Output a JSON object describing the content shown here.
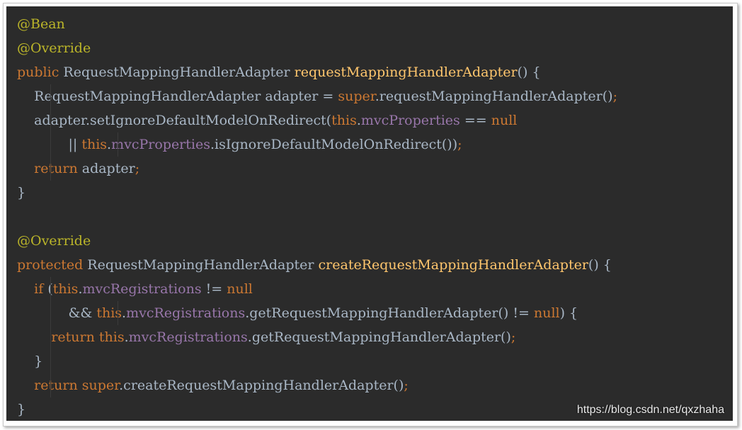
{
  "colors": {
    "background": "#2b2b2b",
    "annotation": "#bbb529",
    "keyword": "#cc7832",
    "method": "#ffc66d",
    "field": "#9876aa",
    "default": "#a9b7c6"
  },
  "code": {
    "lines": [
      {
        "tokens": [
          {
            "t": "@Bean",
            "k": "ann"
          }
        ]
      },
      {
        "tokens": [
          {
            "t": "@Override",
            "k": "ann"
          }
        ]
      },
      {
        "tokens": [
          {
            "t": "public",
            "k": "kw"
          },
          {
            "t": " RequestMappingHandlerAdapter ",
            "k": "def"
          },
          {
            "t": "requestMappingHandlerAdapter",
            "k": "fn"
          },
          {
            "t": "() {",
            "k": "def"
          }
        ]
      },
      {
        "guides": [
          0
        ],
        "tokens": [
          {
            "t": "    RequestMappingHandlerAdapter adapter = ",
            "k": "def"
          },
          {
            "t": "super",
            "k": "kw"
          },
          {
            "t": ".requestMappingHandlerAdapter()",
            "k": "def"
          },
          {
            "t": ";",
            "k": "sym"
          }
        ]
      },
      {
        "guides": [
          0
        ],
        "tokens": [
          {
            "t": "    adapter.setIgnoreDefaultModelOnRedirect(",
            "k": "def"
          },
          {
            "t": "this",
            "k": "kw"
          },
          {
            "t": ".",
            "k": "def"
          },
          {
            "t": "mvcProperties",
            "k": "fld"
          },
          {
            "t": " == ",
            "k": "def"
          },
          {
            "t": "null",
            "k": "kw"
          }
        ]
      },
      {
        "guides": [
          0,
          1
        ],
        "tokens": [
          {
            "t": "            || ",
            "k": "def"
          },
          {
            "t": "this",
            "k": "kw"
          },
          {
            "t": ".",
            "k": "def"
          },
          {
            "t": "mvcProperties",
            "k": "fld"
          },
          {
            "t": ".isIgnoreDefaultModelOnRedirect())",
            "k": "def"
          },
          {
            "t": ";",
            "k": "sym"
          }
        ]
      },
      {
        "guides": [
          0
        ],
        "tokens": [
          {
            "t": "    ",
            "k": "def"
          },
          {
            "t": "return",
            "k": "kw"
          },
          {
            "t": " adapter",
            "k": "def"
          },
          {
            "t": ";",
            "k": "sym"
          }
        ]
      },
      {
        "tokens": [
          {
            "t": "}",
            "k": "def"
          }
        ]
      },
      {
        "tokens": [
          {
            "t": "",
            "k": "def"
          }
        ]
      },
      {
        "tokens": [
          {
            "t": "@Override",
            "k": "ann"
          }
        ]
      },
      {
        "tokens": [
          {
            "t": "protected",
            "k": "kw"
          },
          {
            "t": " RequestMappingHandlerAdapter ",
            "k": "def"
          },
          {
            "t": "createRequestMappingHandlerAdapter",
            "k": "fn"
          },
          {
            "t": "() {",
            "k": "def"
          }
        ]
      },
      {
        "guides": [
          0
        ],
        "tokens": [
          {
            "t": "    ",
            "k": "def"
          },
          {
            "t": "if",
            "k": "kw"
          },
          {
            "t": " (",
            "k": "def"
          },
          {
            "t": "this",
            "k": "kw"
          },
          {
            "t": ".",
            "k": "def"
          },
          {
            "t": "mvcRegistrations",
            "k": "fld"
          },
          {
            "t": " != ",
            "k": "def"
          },
          {
            "t": "null",
            "k": "kw"
          }
        ]
      },
      {
        "guides": [
          0,
          1
        ],
        "tokens": [
          {
            "t": "            && ",
            "k": "def"
          },
          {
            "t": "this",
            "k": "kw"
          },
          {
            "t": ".",
            "k": "def"
          },
          {
            "t": "mvcRegistrations",
            "k": "fld"
          },
          {
            "t": ".getRequestMappingHandlerAdapter() != ",
            "k": "def"
          },
          {
            "t": "null",
            "k": "kw"
          },
          {
            "t": ") {",
            "k": "def"
          }
        ]
      },
      {
        "guides": [
          0
        ],
        "tokens": [
          {
            "t": "        ",
            "k": "def"
          },
          {
            "t": "return",
            "k": "kw"
          },
          {
            "t": " ",
            "k": "def"
          },
          {
            "t": "this",
            "k": "kw"
          },
          {
            "t": ".",
            "k": "def"
          },
          {
            "t": "mvcRegistrations",
            "k": "fld"
          },
          {
            "t": ".getRequestMappingHandlerAdapter()",
            "k": "def"
          },
          {
            "t": ";",
            "k": "sym"
          }
        ]
      },
      {
        "guides": [
          0
        ],
        "tokens": [
          {
            "t": "    }",
            "k": "def"
          }
        ]
      },
      {
        "guides": [
          0
        ],
        "tokens": [
          {
            "t": "    ",
            "k": "def"
          },
          {
            "t": "return",
            "k": "kw"
          },
          {
            "t": " ",
            "k": "def"
          },
          {
            "t": "super",
            "k": "kw"
          },
          {
            "t": ".createRequestMappingHandlerAdapter()",
            "k": "def"
          },
          {
            "t": ";",
            "k": "sym"
          }
        ]
      },
      {
        "tokens": [
          {
            "t": "}",
            "k": "def"
          }
        ]
      }
    ]
  },
  "watermark": {
    "text": "https://blog.csdn.net/qxzhaha"
  }
}
